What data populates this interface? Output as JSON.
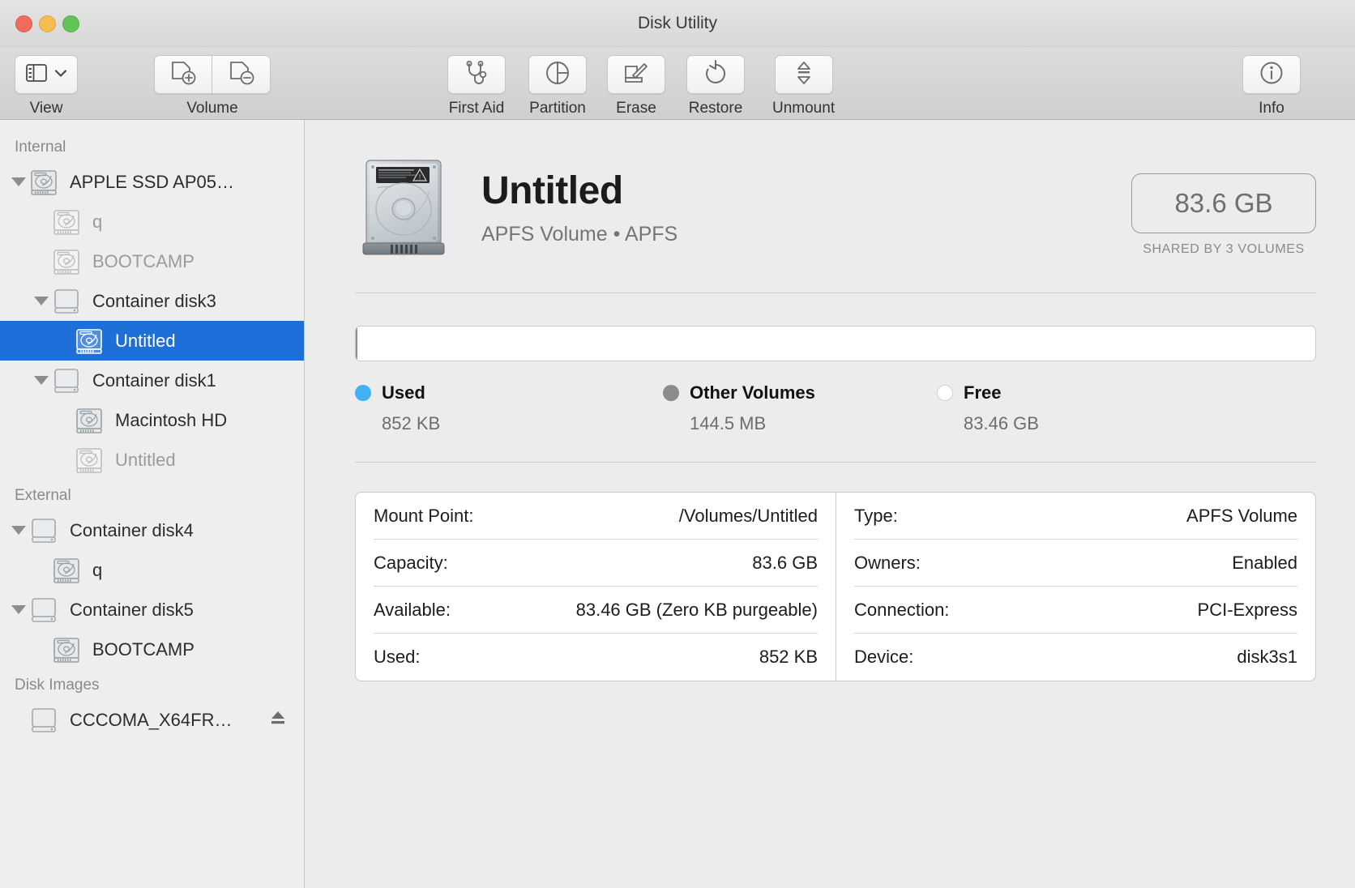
{
  "window": {
    "title": "Disk Utility"
  },
  "toolbar": {
    "view_label": "View",
    "volume_label": "Volume",
    "add_volume_icon": "volume-add-icon",
    "remove_volume_icon": "volume-remove-icon",
    "buttons": [
      {
        "label": "First Aid",
        "icon": "stethoscope-icon"
      },
      {
        "label": "Partition",
        "icon": "pie-chart-icon"
      },
      {
        "label": "Erase",
        "icon": "erase-pencil-icon"
      },
      {
        "label": "Restore",
        "icon": "undo-arrow-icon"
      },
      {
        "label": "Unmount",
        "icon": "eject-updown-icon"
      }
    ],
    "info_label": "Info",
    "info_icon": "info-circle-icon"
  },
  "sidebar": {
    "sections": [
      {
        "header": "Internal",
        "items": [
          {
            "label": "APPLE SSD AP05…",
            "icon": "hard-disk-icon",
            "indent": 0,
            "twisty": "expanded",
            "dimmed": false,
            "selected": false
          },
          {
            "label": "q",
            "icon": "hard-disk-icon",
            "indent": 1,
            "twisty": "none",
            "dimmed": true,
            "selected": false
          },
          {
            "label": "BOOTCAMP",
            "icon": "hard-disk-icon",
            "indent": 1,
            "twisty": "none",
            "dimmed": true,
            "selected": false
          },
          {
            "label": "Container disk3",
            "icon": "container-icon",
            "indent": 1,
            "twisty": "expanded",
            "dimmed": false,
            "selected": false
          },
          {
            "label": "Untitled",
            "icon": "hard-disk-icon",
            "indent": 2,
            "twisty": "none",
            "dimmed": false,
            "selected": true
          },
          {
            "label": "Container disk1",
            "icon": "container-icon",
            "indent": 1,
            "twisty": "expanded",
            "dimmed": false,
            "selected": false
          },
          {
            "label": "Macintosh HD",
            "icon": "hard-disk-icon",
            "indent": 2,
            "twisty": "none",
            "dimmed": false,
            "selected": false
          },
          {
            "label": "Untitled",
            "icon": "hard-disk-icon",
            "indent": 2,
            "twisty": "none",
            "dimmed": true,
            "selected": false
          }
        ]
      },
      {
        "header": "External",
        "items": [
          {
            "label": "Container disk4",
            "icon": "container-icon",
            "indent": 0,
            "twisty": "expanded",
            "dimmed": false,
            "selected": false
          },
          {
            "label": "q",
            "icon": "hard-disk-icon",
            "indent": 1,
            "twisty": "none",
            "dimmed": false,
            "selected": false
          },
          {
            "label": "Container disk5",
            "icon": "container-icon",
            "indent": 0,
            "twisty": "expanded",
            "dimmed": false,
            "selected": false
          },
          {
            "label": "BOOTCAMP",
            "icon": "hard-disk-icon",
            "indent": 1,
            "twisty": "none",
            "dimmed": false,
            "selected": false
          }
        ]
      },
      {
        "header": "Disk Images",
        "items": [
          {
            "label": "CCCOMA_X64FR…",
            "icon": "container-icon",
            "indent": 0,
            "twisty": "none",
            "dimmed": false,
            "selected": false,
            "eject": true
          }
        ]
      }
    ]
  },
  "main": {
    "volume_icon": "large-hard-drive-icon",
    "name": "Untitled",
    "subtitle": "APFS Volume • APFS",
    "capacity_badge": "83.6 GB",
    "capacity_caption": "SHARED BY 3 VOLUMES",
    "legend": [
      {
        "name": "Used",
        "value": "852 KB",
        "color": "#41b2f5",
        "percent": 0.001
      },
      {
        "name": "Other Volumes",
        "value": "144.5 MB",
        "color": "#8c8c8c",
        "percent": 0.17
      },
      {
        "name": "Free",
        "value": "83.46 GB",
        "color": "#ffffff",
        "percent": 99.829
      }
    ],
    "info_left": [
      {
        "key": "Mount Point:",
        "value": "/Volumes/Untitled"
      },
      {
        "key": "Capacity:",
        "value": "83.6 GB"
      },
      {
        "key": "Available:",
        "value": "83.46 GB (Zero KB purgeable)"
      },
      {
        "key": "Used:",
        "value": "852 KB"
      }
    ],
    "info_right": [
      {
        "key": "Type:",
        "value": "APFS Volume"
      },
      {
        "key": "Owners:",
        "value": "Enabled"
      },
      {
        "key": "Connection:",
        "value": "PCI-Express"
      },
      {
        "key": "Device:",
        "value": "disk3s1"
      }
    ]
  }
}
